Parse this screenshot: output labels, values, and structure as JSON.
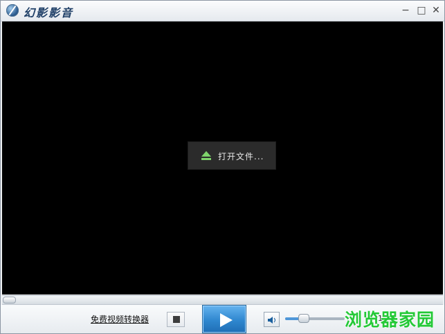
{
  "app": {
    "title": "幻影影音"
  },
  "window_controls": {
    "minimize": "−",
    "maximize": "□",
    "close": "✕"
  },
  "video": {
    "open_button_label": "打开文件..."
  },
  "controls": {
    "converter_link": "免费视频转换器",
    "volume_percent": 30,
    "volume_value_fragment": "1",
    "watermark": "浏览器家园"
  },
  "colors": {
    "video_bg": "#000000",
    "play_button": "#2f87cf",
    "eject_icon": "#7ed36b",
    "watermark": "#23c936"
  }
}
